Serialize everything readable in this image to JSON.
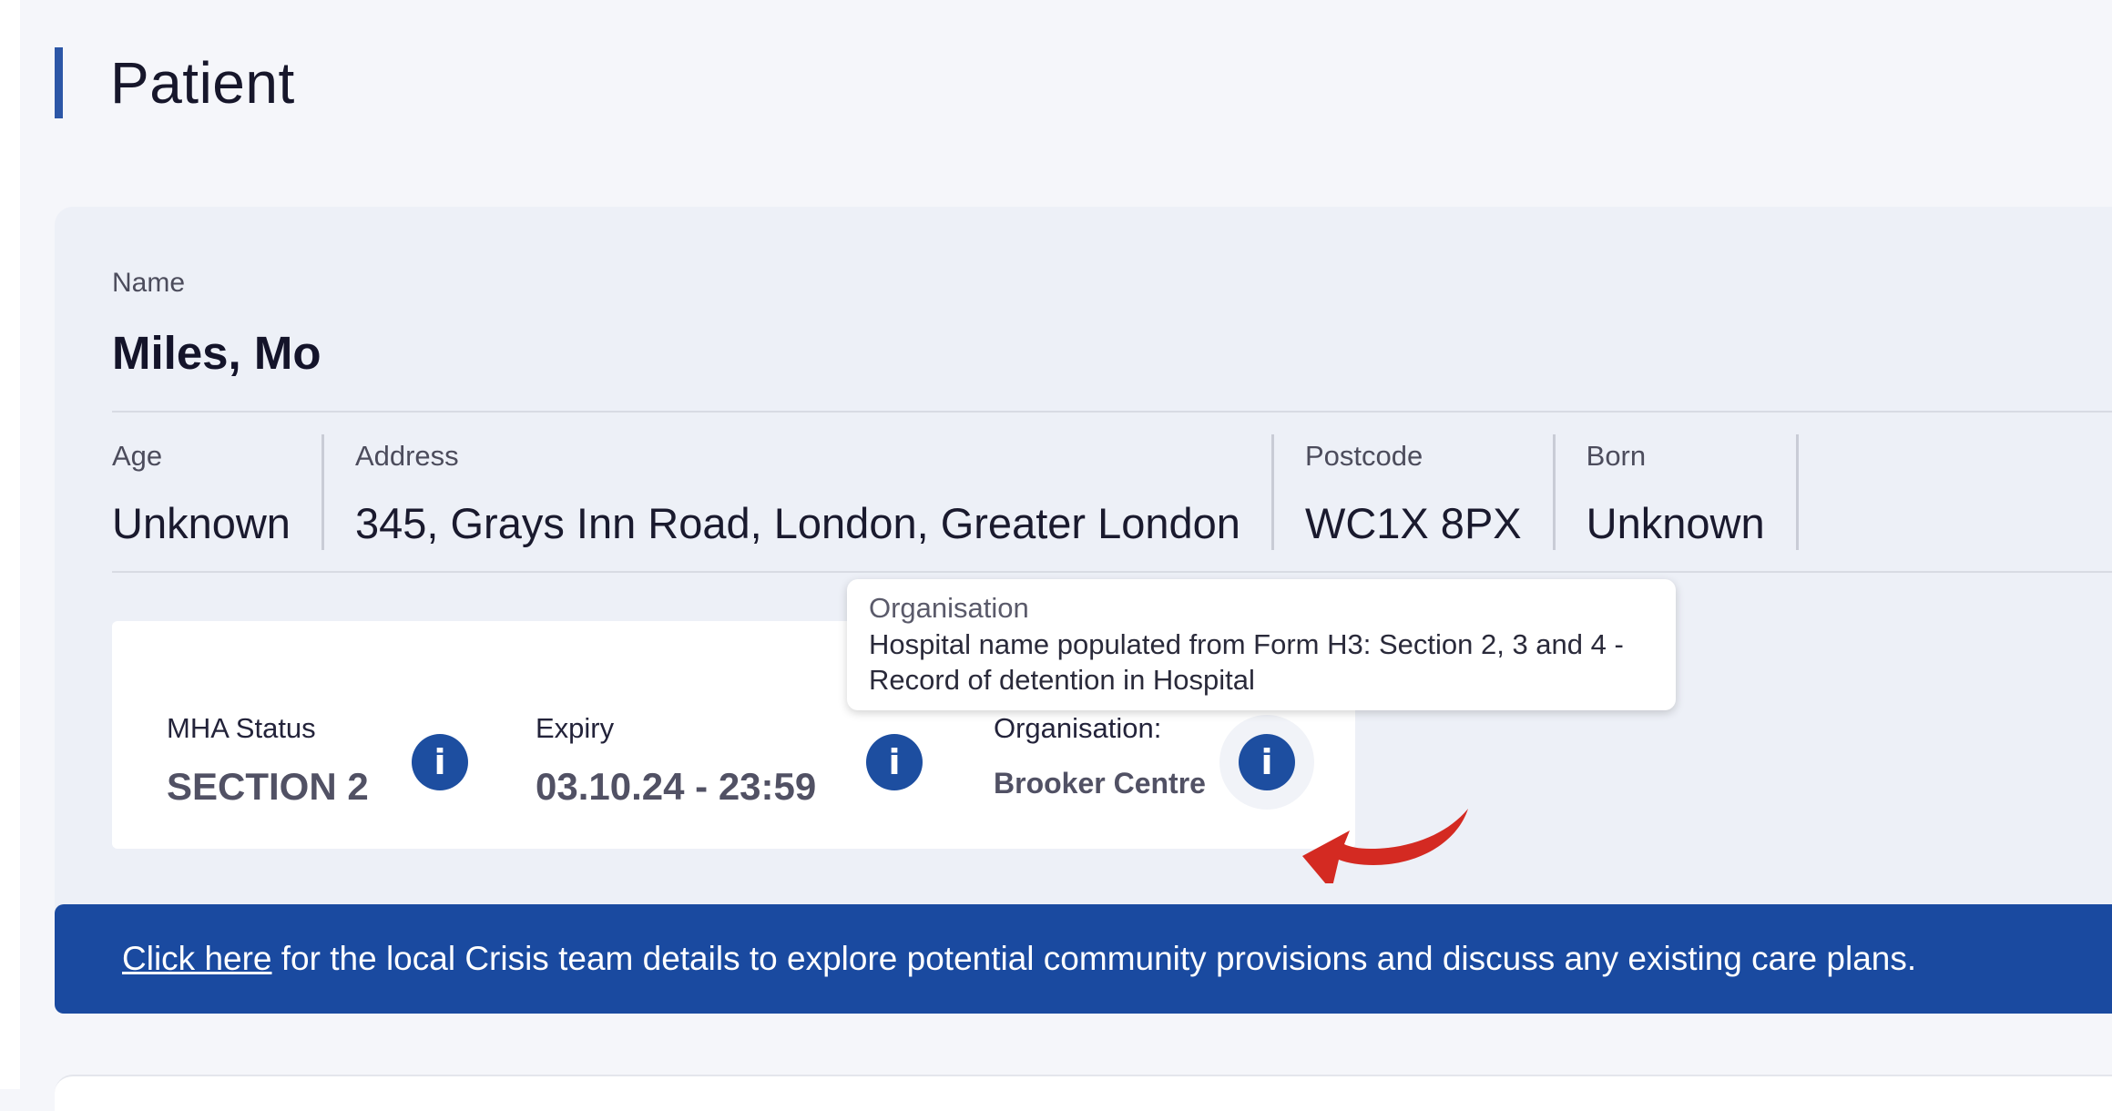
{
  "page": {
    "title": "Patient"
  },
  "patient": {
    "name_label": "Name",
    "name": "Miles, Mo",
    "fields": [
      {
        "label": "Age",
        "value": "Unknown"
      },
      {
        "label": "Address",
        "value": "345, Grays Inn Road, London, Greater London"
      },
      {
        "label": "Postcode",
        "value": "WC1X 8PX"
      },
      {
        "label": "Born",
        "value": "Unknown"
      }
    ]
  },
  "mha": {
    "status_label": "MHA Status",
    "status_value": "SECTION 2",
    "expiry_label": "Expiry",
    "expiry_value": "03.10.24 - 23:59",
    "organisation_label": "Organisation:",
    "organisation_value": "Brooker Centre",
    "info_icon": "i"
  },
  "tooltip": {
    "title": "Organisation",
    "body": "Hospital name populated from Form H3: Section 2, 3 and 4 - Record of detention in Hospital"
  },
  "banner": {
    "link_text": "Click here",
    "text": " for the local Crisis team details to explore potential community provisions and discuss any existing care plans."
  },
  "colors": {
    "accent": "#2c56a6",
    "banner": "#1a4aa0",
    "info_button": "#1d4ea0",
    "annotation_arrow": "#d42a22"
  }
}
